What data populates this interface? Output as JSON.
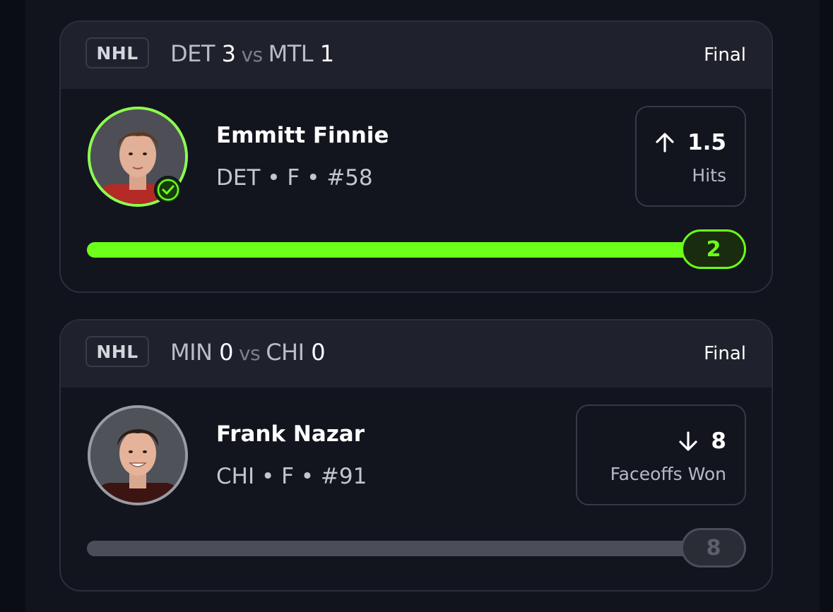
{
  "cards": [
    {
      "league": "NHL",
      "home_team": "DET",
      "home_score": "3",
      "vs": "vs",
      "away_team": "MTL",
      "away_score": "1",
      "status": "Final",
      "player_name": "Emmitt Finnie",
      "player_meta": "DET • F • #58",
      "direction": "up",
      "line": "1.5",
      "stat": "Hits",
      "result": "2",
      "progress": 1.0,
      "hit": true
    },
    {
      "league": "NHL",
      "home_team": "MIN",
      "home_score": "0",
      "vs": "vs",
      "away_team": "CHI",
      "away_score": "0",
      "status": "Final",
      "player_name": "Frank Nazar",
      "player_meta": "CHI • F • #91",
      "direction": "down",
      "line": "8",
      "stat": "Faceoffs Won",
      "result": "8",
      "progress": 1.0,
      "hit": false
    }
  ],
  "colors": {
    "accent_green": "#6cff1a",
    "neutral_gray": "#4b4e58",
    "avatar_ring_win": "#8dff4f",
    "avatar_ring_neutral": "#9a9ca4"
  },
  "icons": {
    "check": "checkmark-circle-icon",
    "up": "arrow-up-icon",
    "down": "arrow-down-icon",
    "avatar": "player-headshot"
  }
}
